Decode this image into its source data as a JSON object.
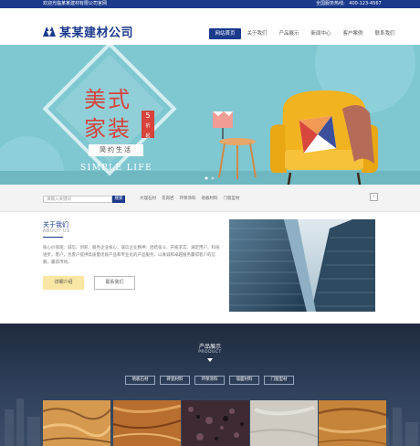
{
  "topbar": {
    "welcome": "欢迎光临某某建材有限公司官网",
    "hotline_label": "全国服务热线:",
    "hotline_number": "400-123-4567"
  },
  "header": {
    "logo_text": "某某建材公司"
  },
  "nav": {
    "items": [
      "网站首页",
      "关于我们",
      "产品展示",
      "新闻中心",
      "客户案例",
      "联系我们"
    ]
  },
  "banner": {
    "headline_line1": "美式",
    "headline_line2": "家装",
    "discount_number": "5",
    "discount_unit": "折",
    "discount_suffix": "起",
    "tagline": "简约生活",
    "tagline_en": "SIMPLE LIFE"
  },
  "search": {
    "placeholder": "请输入关键词",
    "button_label": "搜索",
    "hot_keywords": [
      "大理石材",
      "花岗岩",
      "环保涂料",
      "地板材料",
      "门窗型材"
    ],
    "arrow": "›"
  },
  "about": {
    "title": "关于我们",
    "title_en": "ABOUT US",
    "text": "核心价值观：诚信、创新、服务企业核心，诚信企业精神：团结奋斗、开拓求实、满足用户、科技进步。客户，为客户提供高质量优质产品和专业化的产品服务，以真诚和卓越服务赢得客户的信赖，赢得市场。",
    "detail_button": "详细介绍",
    "contact_button": "联系我们"
  },
  "products": {
    "title": "产品展示",
    "title_en": "PRODUCT",
    "tabs": [
      "地板石材",
      "砖瓷材料",
      "环保涂料",
      "墙面材料",
      "门窗型材"
    ]
  },
  "colors": {
    "brand": "#1b3a8c",
    "banner_bg": "#7fc7d1",
    "accent_red": "#d7423b",
    "button_yellow": "#f8e7a4"
  }
}
